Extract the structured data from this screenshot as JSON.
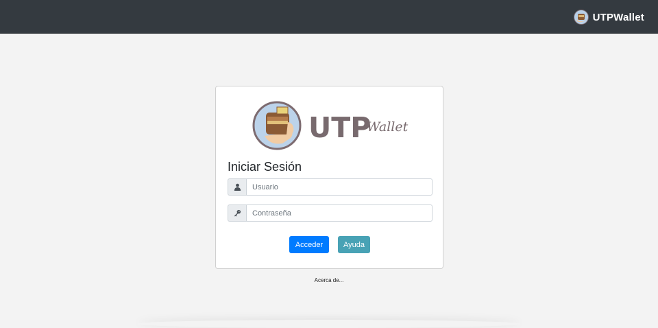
{
  "navbar": {
    "brand": "UTPWallet",
    "logo_icon": "wallet-hand-icon",
    "background": "#343a40"
  },
  "login_card": {
    "logo_icon": "wallet-hand-icon",
    "logo_text": "UTP",
    "logo_subtext": "Wallet",
    "title": "Iniciar Sesión",
    "username": {
      "icon": "user-icon",
      "placeholder": "Usuario",
      "value": ""
    },
    "password": {
      "icon": "key-icon",
      "placeholder": "Contraseña",
      "value": ""
    },
    "submit_label": "Acceder",
    "help_label": "Ayuda",
    "colors": {
      "primary": "#007bff",
      "info": "#48a2b5",
      "logo_text": "#786a6e"
    }
  },
  "footer": {
    "about_label": "Acerca de..."
  }
}
